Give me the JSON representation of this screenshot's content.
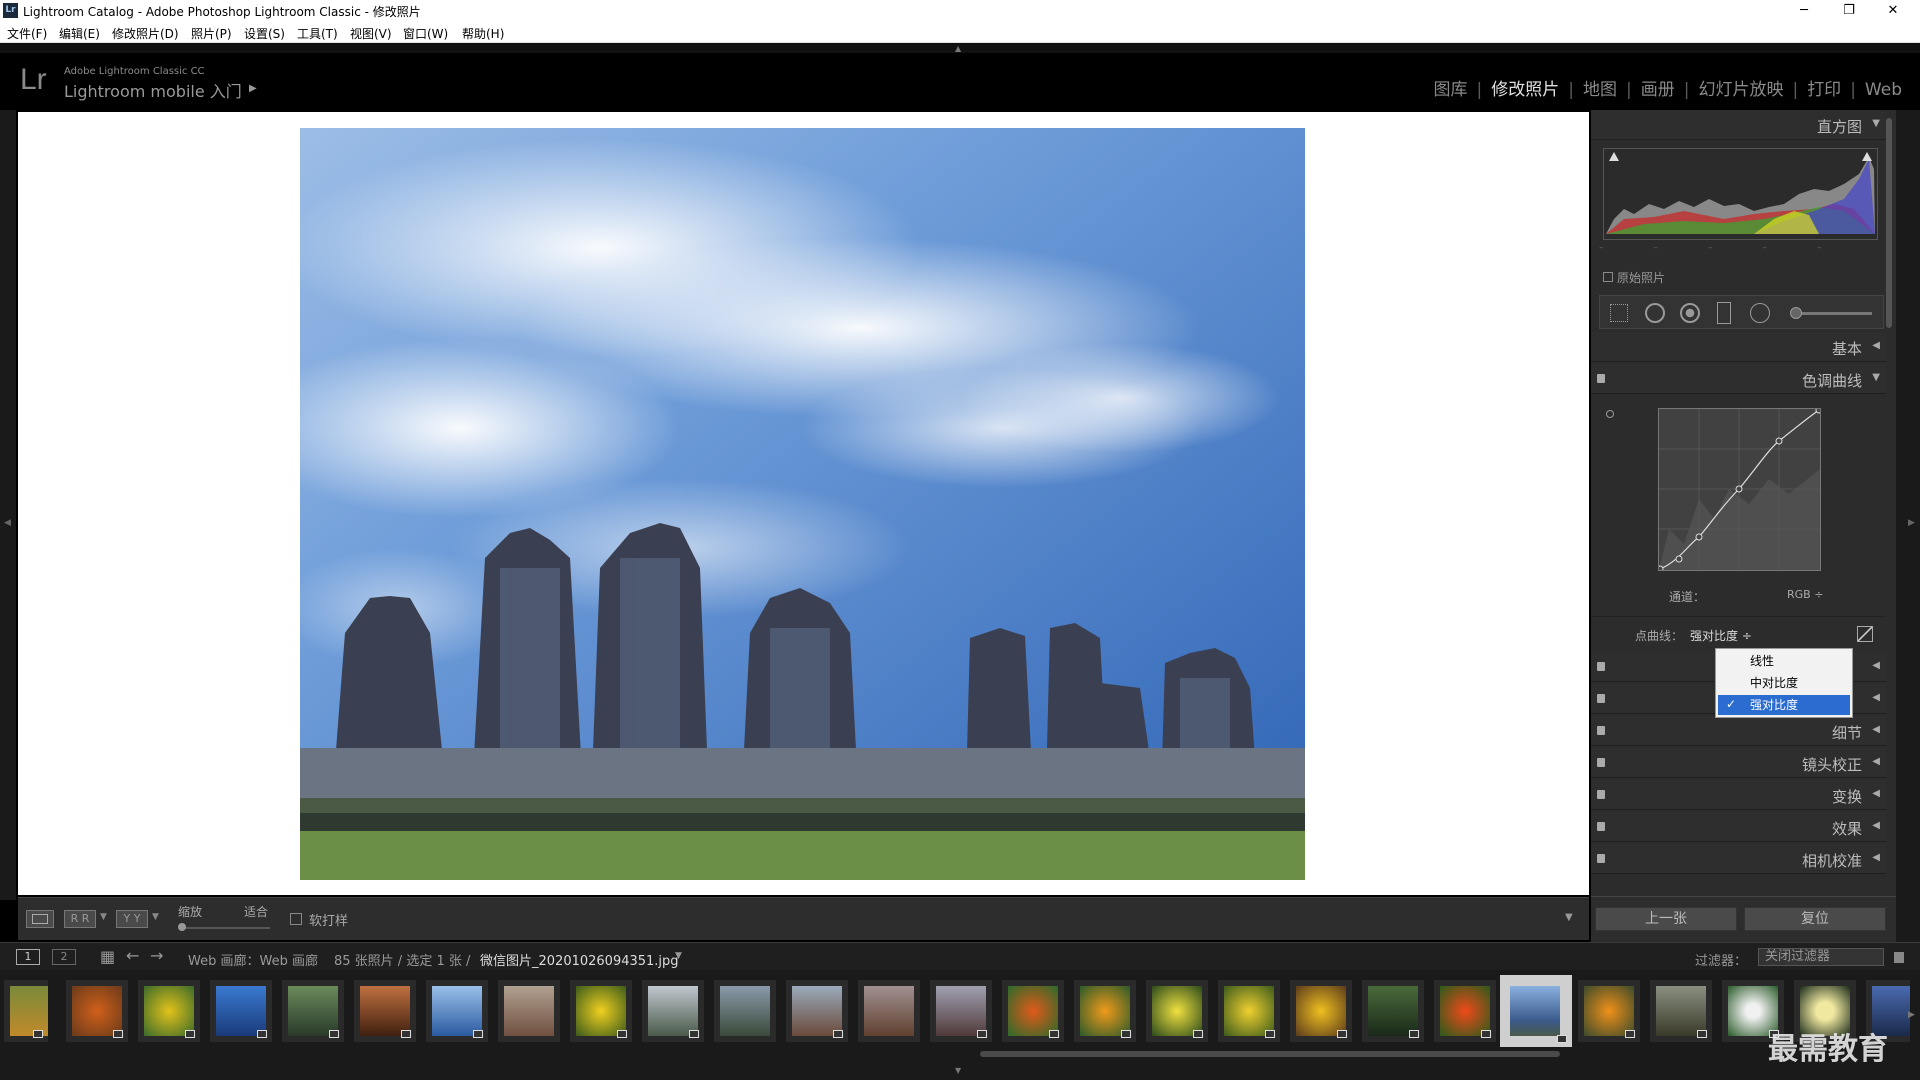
{
  "window": {
    "title": "Lightroom Catalog - Adobe Photoshop Lightroom Classic - 修改照片",
    "app_icon": "Lr"
  },
  "menu": [
    "文件(F)",
    "编辑(E)",
    "修改照片(D)",
    "照片(P)",
    "设置(S)",
    "工具(T)",
    "视图(V)",
    "窗口(W)",
    "帮助(H)"
  ],
  "identity": {
    "logo": "Lr",
    "brand_small": "Adobe Lightroom Classic CC",
    "brand_main": "Lightroom mobile 入门"
  },
  "modules": {
    "library": "图库",
    "develop": "修改照片",
    "map": "地图",
    "book": "画册",
    "slideshow": "幻灯片放映",
    "print": "打印",
    "web": "Web"
  },
  "toolbar": {
    "zoom_label": "缩放",
    "fit_label": "适合",
    "softproof_label": "软打样",
    "view_btn2": "R R",
    "view_btn3": "Y Y"
  },
  "panels": {
    "histogram": "直方图",
    "original_photo": "原始照片",
    "basic": "基本",
    "tone_curve": "色调曲线",
    "channel_label": "通道：",
    "channel_value": "RGB ÷",
    "point_curve_label": "点曲线：",
    "point_curve_value": "强对比度 ÷",
    "detail": "细节",
    "lens": "镜头校正",
    "transform": "变换",
    "effects": "效果",
    "calibration": "相机校准",
    "prev_button": "上一张",
    "reset_button": "复位"
  },
  "dropdown": [
    "线性",
    "中对比度",
    "强对比度"
  ],
  "dropdown_selected": 2,
  "filmbar": {
    "screen1": "1",
    "screen2": "2",
    "source": "Web 画廊：Web 画廊",
    "count": "85 张照片 / 选定 1 张 /",
    "filename": "微信图片_20201026094351.jpg",
    "filter_label": "过滤器：",
    "filter_value": "关闭过滤器"
  },
  "watermark": "最需教育",
  "colors": {
    "accent": "#2b6cd1",
    "panel": "#2c2c2c",
    "sky": "#3f78c0"
  }
}
